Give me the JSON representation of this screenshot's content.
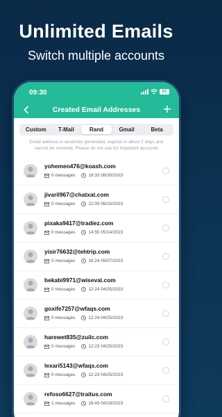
{
  "promo": {
    "headline": "Unlimited Emails",
    "subhead": "Switch multiple accounts"
  },
  "status_bar": {
    "time": "09:30",
    "battery": "62"
  },
  "app_bar": {
    "title": "Created Email Addresses",
    "back_icon": "chevron-left-icon",
    "add_icon": "plus-icon"
  },
  "tabs": [
    {
      "label": "Custom",
      "active": false
    },
    {
      "label": "T-Mail",
      "active": false
    },
    {
      "label": "Rand",
      "active": true
    },
    {
      "label": "Gmail",
      "active": false
    },
    {
      "label": "Beta",
      "active": false
    }
  ],
  "notice": "Email address is randomly generated, expires in about 2 days and cannot be restored. Please do not use for important accounts",
  "emails": [
    {
      "address": "yohemen476@koash.com",
      "messages": "0 messages",
      "timestamp": "18:33 08/30/2023"
    },
    {
      "address": "jivaril967@chatxat.com",
      "messages": "0 messages",
      "timestamp": "22:09 06/15/2023"
    },
    {
      "address": "pixaka9417@tradiez.com",
      "messages": "0 messages",
      "timestamp": "14:55 05/14/2023"
    },
    {
      "address": "yisir76632@tehtrip.com",
      "messages": "0 messages",
      "timestamp": "16:24 05/07/2023"
    },
    {
      "address": "bekabi9971@wiseval.com",
      "messages": "0 messages",
      "timestamp": "12:24 04/25/2023"
    },
    {
      "address": "goxife7257@wfaqs.com",
      "messages": "0 messages",
      "timestamp": "12:24 04/25/2023"
    },
    {
      "address": "harewet835@zuilc.com",
      "messages": "0 messages",
      "timestamp": "12:23 04/25/2023"
    },
    {
      "address": "lexari5143@wfaqs.com",
      "messages": "0 messages",
      "timestamp": "12:23 04/25/2023"
    },
    {
      "address": "refoso6627@traitus.com",
      "messages": "1 messages",
      "timestamp": "16:43 04/19/2023"
    }
  ],
  "colors": {
    "accent": "#23bb98",
    "background": "#0b3252"
  }
}
